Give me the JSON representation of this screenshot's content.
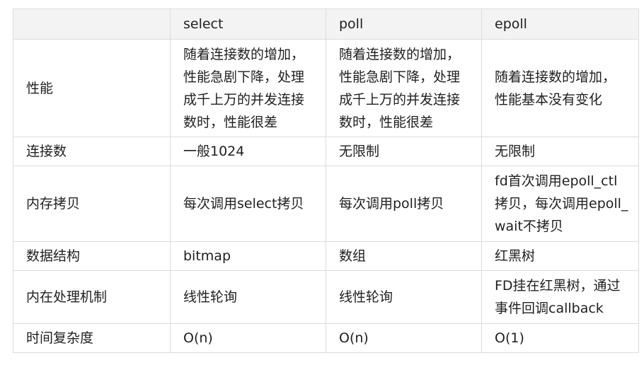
{
  "table": {
    "headers": [
      "",
      "select",
      "poll",
      "epoll"
    ],
    "rows": [
      {
        "label": "性能",
        "select": "随着连接数的增加，性能急剧下降，处理成千上万的并发连接数时，性能很差",
        "poll": "随着连接数的增加，性能急剧下降，处理成千上万的并发连接数时，性能很差",
        "epoll": "随着连接数的增加，性能基本没有变化"
      },
      {
        "label": "连接数",
        "select": "一般1024",
        "poll": "无限制",
        "epoll": "无限制"
      },
      {
        "label": "内存拷贝",
        "select": "每次调用select拷贝",
        "poll": "每次调用poll拷贝",
        "epoll": "fd首次调用epoll_ctl拷贝，每次调用epoll_wait不拷贝"
      },
      {
        "label": "数据结构",
        "select": "bitmap",
        "poll": "数组",
        "epoll": "红黑树"
      },
      {
        "label": "内在处理机制",
        "select": "线性轮询",
        "poll": "线性轮询",
        "epoll": "FD挂在红黑树，通过事件回调callback"
      },
      {
        "label": "时间复杂度",
        "select": "O(n)",
        "poll": "O(n)",
        "epoll": "O(1)"
      }
    ]
  }
}
